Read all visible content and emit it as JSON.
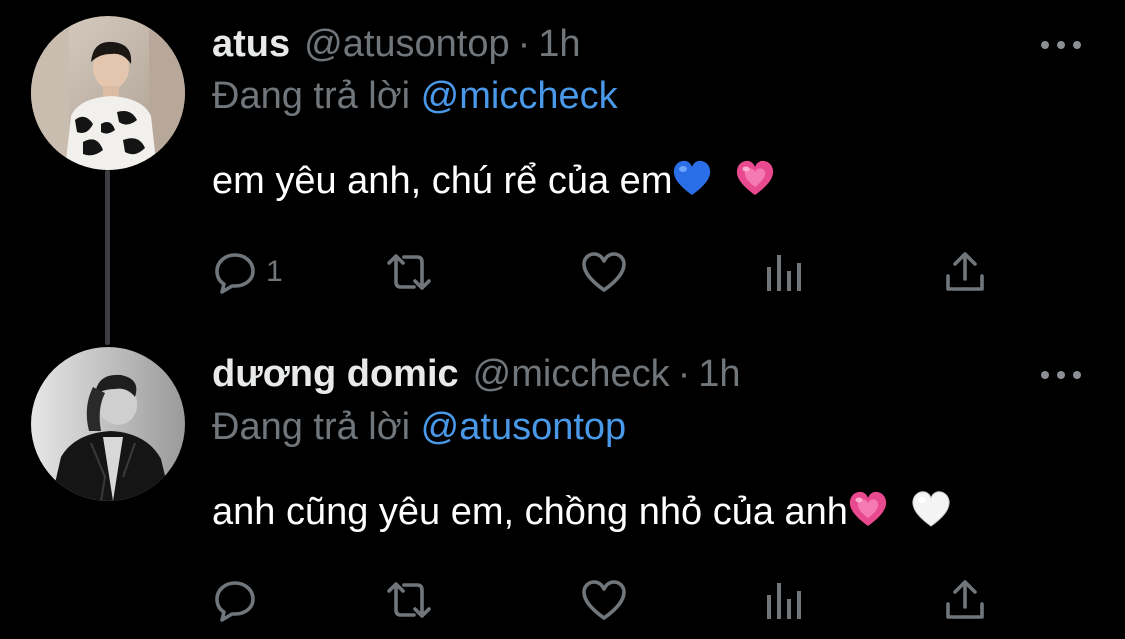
{
  "tweets": [
    {
      "display_name": "atus",
      "handle": "@atusontop",
      "separator": "·",
      "time": "1h",
      "reply_prefix": "Đang trả lời",
      "reply_mention": "@miccheck",
      "text": "em yêu anh, chú rể của em",
      "emojis": [
        "blue-heart",
        "growing-heart"
      ],
      "reply_count": "1",
      "avatar_style": "warm-toned photo, person in black-and-white knit sweater"
    },
    {
      "display_name": "dương domic",
      "handle": "@miccheck",
      "separator": "·",
      "time": "1h",
      "reply_prefix": "Đang trả lời",
      "reply_mention": "@atusontop",
      "text": "anh cũng yêu em, chồng nhỏ của anh",
      "emojis": [
        "growing-heart",
        "white-heart"
      ],
      "reply_count": "",
      "avatar_style": "grayscale photo, person in dark jacket"
    }
  ],
  "colors": {
    "background": "#000000",
    "primary_text": "#ffffff",
    "secondary_text": "#71767b",
    "link": "#4a99e9",
    "thread_line": "#3b3d40"
  },
  "icons": [
    "reply-icon",
    "retweet-icon",
    "like-icon",
    "stats-icon",
    "share-icon",
    "more-icon"
  ]
}
